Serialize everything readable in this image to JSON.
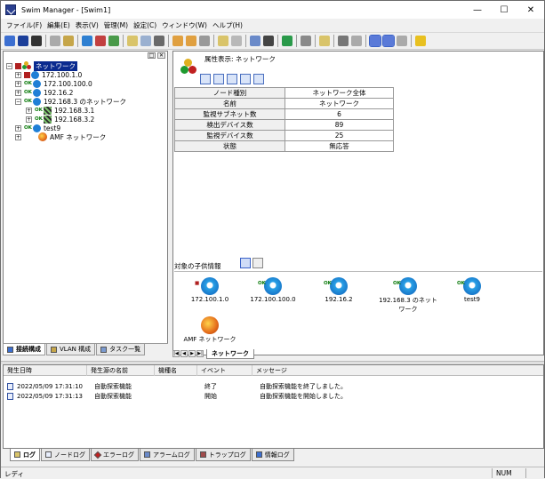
{
  "window": {
    "title": "Swim Manager - [Swim1]"
  },
  "menu": [
    "ファイル(F)",
    "編集(E)",
    "表示(V)",
    "管理(M)",
    "設定(C)",
    "ウィンドウ(W)",
    "ヘルプ(H)"
  ],
  "tree": {
    "root": "ネットワーク",
    "items": [
      "172.100.1.0",
      "172.100.100.0",
      "192.16.2",
      "192.168.3 のネットワーク",
      "192.168.3.1",
      "192.168.3.2",
      "test9",
      "AMF ネットワーク"
    ]
  },
  "left_tabs": [
    "接続構成",
    "VLAN 構成",
    "タスク一覧"
  ],
  "properties": {
    "title": "属性表示: ネットワーク",
    "rows": [
      {
        "key": "ノード種別",
        "value": "ネットワーク全体"
      },
      {
        "key": "名前",
        "value": "ネットワーク"
      },
      {
        "key": "監視サブネット数",
        "value": "6"
      },
      {
        "key": "検出デバイス数",
        "value": "89"
      },
      {
        "key": "監視デバイス数",
        "value": "25"
      },
      {
        "key": "状態",
        "value": "無応答"
      }
    ]
  },
  "children": {
    "title": "対象の子供情報",
    "items": [
      {
        "label": "172.100.1.0",
        "mark": "red"
      },
      {
        "label": "172.100.100.0",
        "mark": "OK"
      },
      {
        "label": "192.16.2",
        "mark": "OK"
      },
      {
        "label": "192.168.3 のネットワーク",
        "mark": "OK"
      },
      {
        "label": "test9",
        "mark": "OK"
      },
      {
        "label": "AMF ネットワーク",
        "mark": ""
      }
    ]
  },
  "right_tab": "ネットワーク",
  "log": {
    "headers": [
      "発生日時",
      "発生源の名前",
      "機種名",
      "イベント",
      "メッセージ"
    ],
    "rows": [
      {
        "time": "2022/05/09 17:31:10",
        "source": "自動探索機能",
        "model": "",
        "event": "終了",
        "message": "自動探索機能を終了しました。"
      },
      {
        "time": "2022/05/09 17:31:13",
        "source": "自動探索機能",
        "model": "",
        "event": "開始",
        "message": "自動探索機能を開始しました。"
      }
    ]
  },
  "log_tabs": [
    "ログ",
    "ノードログ",
    "エラーログ",
    "アラームログ",
    "トラップログ",
    "情報ログ"
  ],
  "status": {
    "left": "レディ",
    "right": "NUM"
  },
  "ok_mark": "OK",
  "colors": {
    "accent": "#0a2a8f",
    "ok": "#0a7a0a",
    "alarm": "#b02020"
  }
}
